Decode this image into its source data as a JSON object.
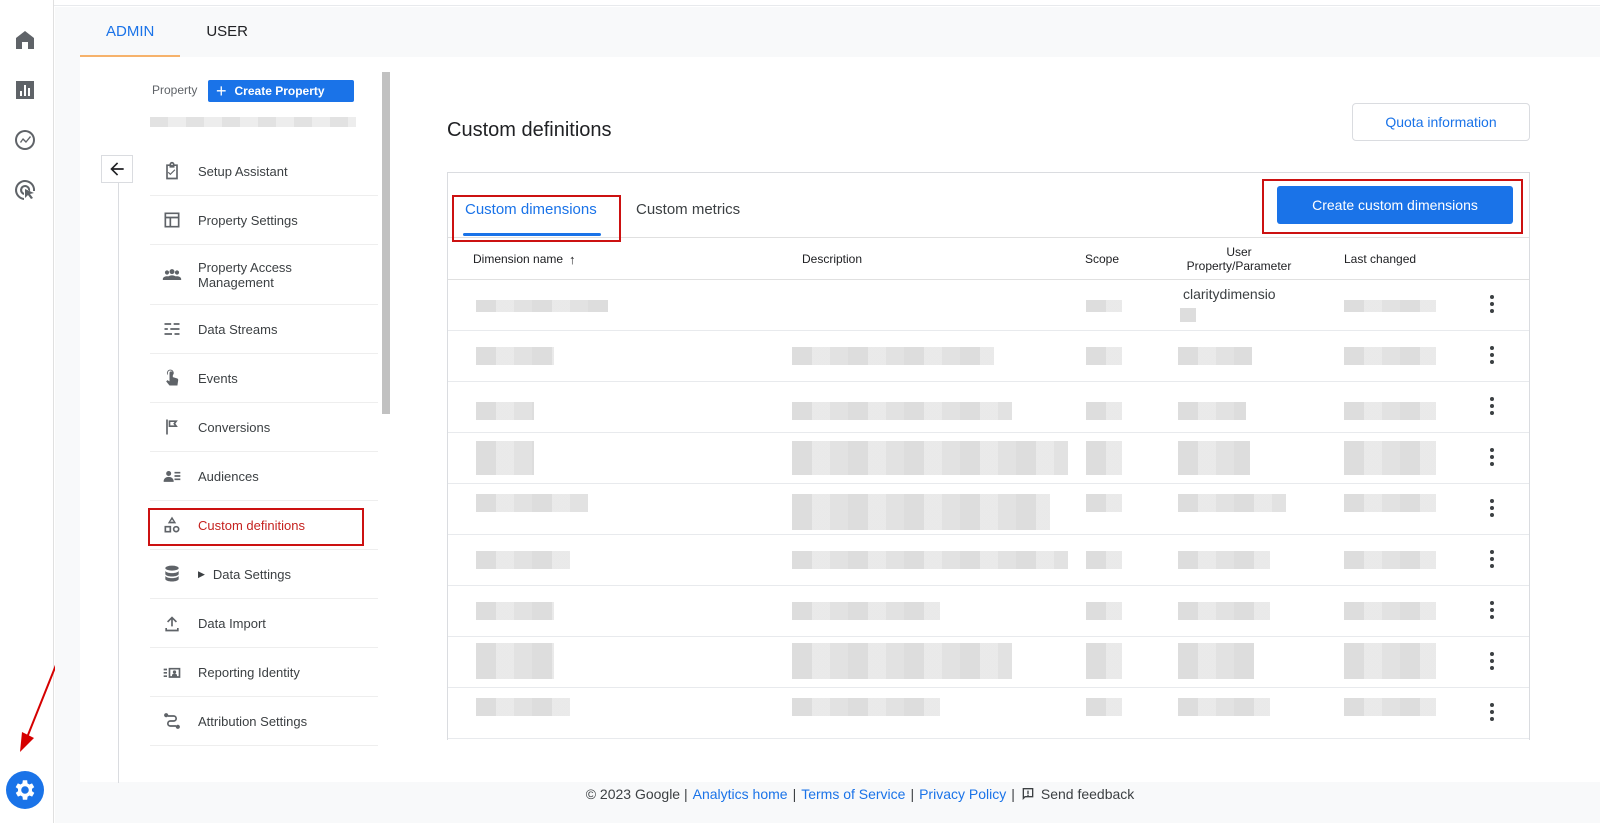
{
  "top_tabs": [
    {
      "label": "ADMIN",
      "active": true
    },
    {
      "label": "USER",
      "active": false
    }
  ],
  "property": {
    "label": "Property",
    "create_button": "Create Property"
  },
  "nav_items": [
    {
      "label": "Setup Assistant",
      "icon": "checklist-icon"
    },
    {
      "label": "Property Settings",
      "icon": "layout-icon"
    },
    {
      "label": "Property Access Management",
      "icon": "people-icon"
    },
    {
      "label": "Data Streams",
      "icon": "streams-icon"
    },
    {
      "label": "Events",
      "icon": "touch-icon"
    },
    {
      "label": "Conversions",
      "icon": "flag-icon"
    },
    {
      "label": "Audiences",
      "icon": "audience-icon"
    },
    {
      "label": "Custom definitions",
      "icon": "shapes-icon",
      "active": true
    },
    {
      "label": "Data Settings",
      "icon": "database-icon"
    },
    {
      "label": "Data Import",
      "icon": "upload-icon"
    },
    {
      "label": "Reporting Identity",
      "icon": "identity-icon"
    },
    {
      "label": "Attribution Settings",
      "icon": "attribution-icon"
    }
  ],
  "page": {
    "title": "Custom definitions",
    "quota_button": "Quota information"
  },
  "card": {
    "tabs": [
      "Custom dimensions",
      "Custom metrics"
    ],
    "create_button": "Create custom dimensions",
    "columns": [
      "Dimension name",
      "Description",
      "Scope",
      "User Property/Parameter",
      "Last changed"
    ],
    "first_row_param": "claritydimensio",
    "row_count": 9
  },
  "footer": {
    "copyright": "© 2023 Google |",
    "links": [
      "Analytics home",
      "Terms of Service",
      "Privacy Policy"
    ],
    "sep": "|",
    "feedback": "Send feedback"
  },
  "colors": {
    "accent": "#1a73e8",
    "highlight": "#cc1111"
  }
}
